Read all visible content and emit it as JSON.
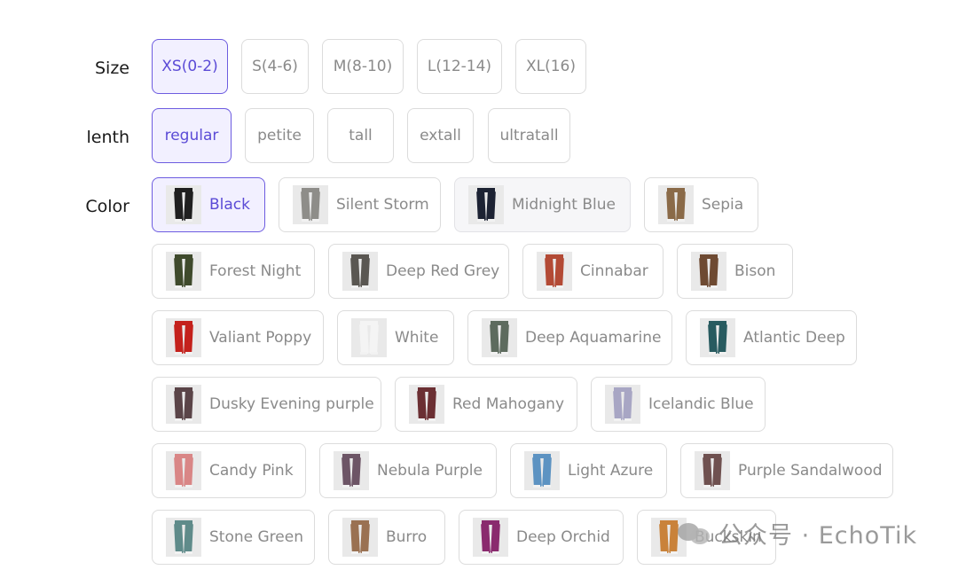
{
  "size": {
    "label": "Size",
    "options": [
      {
        "text": "XS(0-2)",
        "selected": true
      },
      {
        "text": "S(4-6)"
      },
      {
        "text": "M(8-10)"
      },
      {
        "text": "L(12-14)"
      },
      {
        "text": "XL(16)"
      }
    ]
  },
  "length": {
    "label": "lenth",
    "options": [
      {
        "text": "regular",
        "selected": true
      },
      {
        "text": "petite"
      },
      {
        "text": "tall"
      },
      {
        "text": "extall"
      },
      {
        "text": "ultratall"
      }
    ]
  },
  "color": {
    "label": "Color",
    "options": [
      {
        "text": "Black",
        "swatch": "#1f1f1f",
        "selected": true
      },
      {
        "text": "Silent Storm",
        "swatch": "#8e8d89"
      },
      {
        "text": "Midnight Blue",
        "swatch": "#1c2233",
        "hovered": true
      },
      {
        "text": "Sepia",
        "swatch": "#8a6a48"
      },
      {
        "text": "Forest Night",
        "swatch": "#3f4a2c"
      },
      {
        "text": "Deep Red Grey",
        "swatch": "#5a5752"
      },
      {
        "text": "Cinnabar",
        "swatch": "#b34a35"
      },
      {
        "text": "Bison",
        "swatch": "#6e4a32"
      },
      {
        "text": "Valiant Poppy",
        "swatch": "#c4211c"
      },
      {
        "text": "White",
        "swatch": "#f4f4f4"
      },
      {
        "text": "Deep Aquamarine",
        "swatch": "#5d6b5e"
      },
      {
        "text": "Atlantic Deep",
        "swatch": "#285b60"
      },
      {
        "text": "Dusky Evening purple",
        "swatch": "#5a4448"
      },
      {
        "text": "Red Mahogany",
        "swatch": "#6b2f33"
      },
      {
        "text": "Icelandic Blue",
        "swatch": "#a8a6c4"
      },
      {
        "text": "Candy Pink",
        "swatch": "#d98686"
      },
      {
        "text": "Nebula Purple",
        "swatch": "#6d5566"
      },
      {
        "text": "Light Azure",
        "swatch": "#5d93c2"
      },
      {
        "text": "Purple Sandalwood",
        "swatch": "#6f5150"
      },
      {
        "text": "Stone Green",
        "swatch": "#5f8b8a"
      },
      {
        "text": "Burro",
        "swatch": "#9a7152"
      },
      {
        "text": "Deep Orchid",
        "swatch": "#8a2a6e"
      },
      {
        "text": "Buckskin",
        "swatch": "#c9823a"
      }
    ]
  },
  "watermark": {
    "text": "公众号 · EchoTik"
  }
}
